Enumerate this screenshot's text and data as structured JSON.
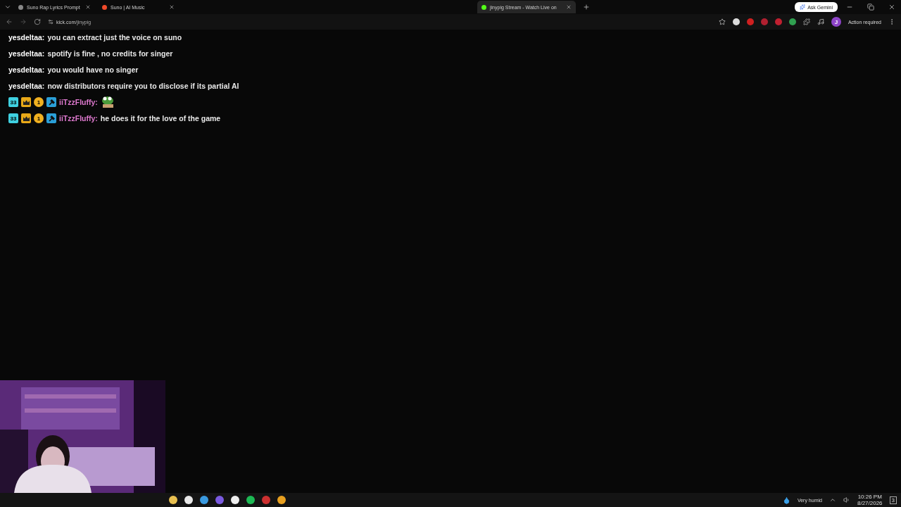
{
  "browser": {
    "tabs": [
      {
        "title": "Suno Rap Lyrics Prompt",
        "selected": false
      },
      {
        "title": "Suno | AI Music",
        "selected": false
      },
      {
        "title": "jinypig Stream - Watch Live on",
        "selected": true
      }
    ],
    "address": {
      "domain": "kick.com",
      "path": "/jinypig"
    },
    "gemini_button": "Ask Gemini",
    "profile_initial": "J",
    "action_button": "Action required"
  },
  "chat": [
    {
      "user": "yesdeltaa:",
      "color": "#ffffff",
      "text": "you can extract just the voice on suno"
    },
    {
      "user": "yesdeltaa:",
      "color": "#ffffff",
      "text": "spotify is fine , no credits for singer"
    },
    {
      "user": "yesdeltaa:",
      "color": "#ffffff",
      "text": "you would have no singer"
    },
    {
      "user": "yesdeltaa:",
      "color": "#ffffff",
      "text": "now distributors require you to disclose if its partial AI"
    },
    {
      "user": "iiTzzFluffy:",
      "color": "#e07ad0",
      "badges": [
        {
          "kind": "subscriber",
          "text": "33"
        },
        {
          "kind": "crown"
        },
        {
          "kind": "gifter",
          "text": "1"
        },
        {
          "kind": "moderator"
        }
      ],
      "emote": true
    },
    {
      "user": "iiTzzFluffy:",
      "color": "#e07ad0",
      "badges": [
        {
          "kind": "subscriber",
          "text": "33"
        },
        {
          "kind": "crown"
        },
        {
          "kind": "gifter",
          "text": "1"
        },
        {
          "kind": "moderator"
        }
      ],
      "text": "he does it for the love of the game"
    }
  ],
  "taskbar": {
    "weather": "Very humid",
    "time": "10:26 PM",
    "date": "8/27/2026",
    "notifications": "3"
  }
}
